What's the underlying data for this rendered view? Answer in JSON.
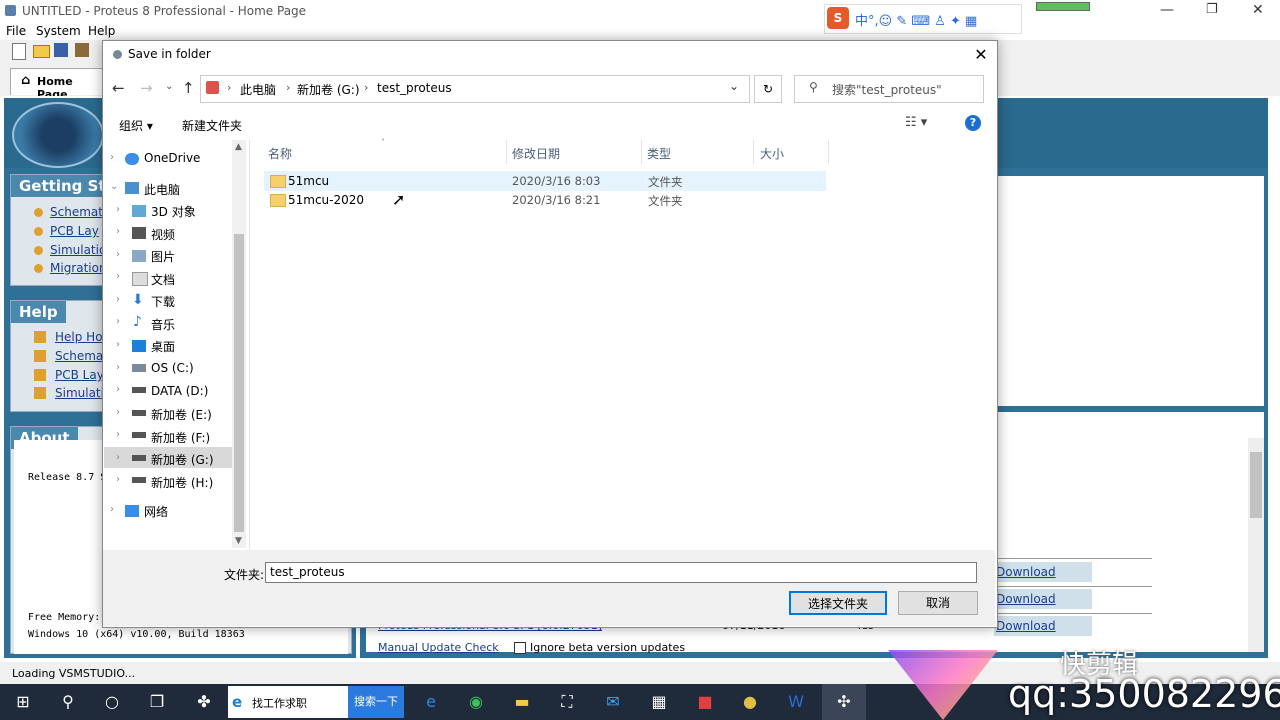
{
  "app": {
    "title": "UNTITLED - Proteus 8 Professional - Home Page",
    "menu": [
      "File",
      "System",
      "Help"
    ],
    "home_tab": "Home Page",
    "panels": {
      "getting_started": {
        "title": "Getting Sta",
        "links": [
          "Schemati",
          "PCB Lay",
          "Simulatio",
          "Migration"
        ]
      },
      "help": {
        "title": "Help",
        "links": [
          "Help Hor",
          "Schemat",
          "PCB Lay",
          "Simulatio"
        ]
      },
      "about": {
        "title": "About",
        "line1": "Release 8.7 S",
        "line2": "Free Memory:",
        "line3": "Windows 10 (x64) v10.00, Build 18363"
      }
    },
    "updates": {
      "download_label": "Download",
      "row_text": "Proteus Professional 8.6 SP1 [8.6.27051]",
      "row_date": "07/11/2016",
      "row_flag": "Yes",
      "manual_check": "Manual Update Check",
      "ignore_beta": "Ignore beta version updates"
    },
    "status": "Loading VSMSTUDIO..."
  },
  "dialog": {
    "title": "Save in folder",
    "breadcrumb": [
      "此电脑",
      "新加卷 (G:)",
      "test_proteus"
    ],
    "search_placeholder": "搜索\"test_proteus\"",
    "toolbar": {
      "organize": "组织 ▾",
      "new_folder": "新建文件夹"
    },
    "nav_items": [
      {
        "label": "OneDrive"
      },
      {
        "label": "此电脑"
      },
      {
        "label": "3D 对象"
      },
      {
        "label": "视频"
      },
      {
        "label": "图片"
      },
      {
        "label": "文档"
      },
      {
        "label": "下载"
      },
      {
        "label": "音乐"
      },
      {
        "label": "桌面"
      },
      {
        "label": "OS (C:)"
      },
      {
        "label": "DATA (D:)"
      },
      {
        "label": "新加卷 (E:)"
      },
      {
        "label": "新加卷 (F:)"
      },
      {
        "label": "新加卷 (G:)"
      },
      {
        "label": "新加卷 (H:)"
      },
      {
        "label": "网络"
      }
    ],
    "columns": [
      "名称",
      "修改日期",
      "类型",
      "大小"
    ],
    "files": [
      {
        "name": "51mcu",
        "date": "2020/3/16 8:03",
        "type": "文件夹"
      },
      {
        "name": "51mcu-2020",
        "date": "2020/3/16 8:21",
        "type": "文件夹"
      }
    ],
    "folder_label": "文件夹:",
    "folder_value": "test_proteus",
    "select_button": "选择文件夹",
    "cancel_button": "取消"
  },
  "taskbar": {
    "search_text": "找工作求职",
    "search_button": "搜索一下"
  },
  "watermark": {
    "qq": "qq:350082296",
    "brand": "快剪辑"
  }
}
